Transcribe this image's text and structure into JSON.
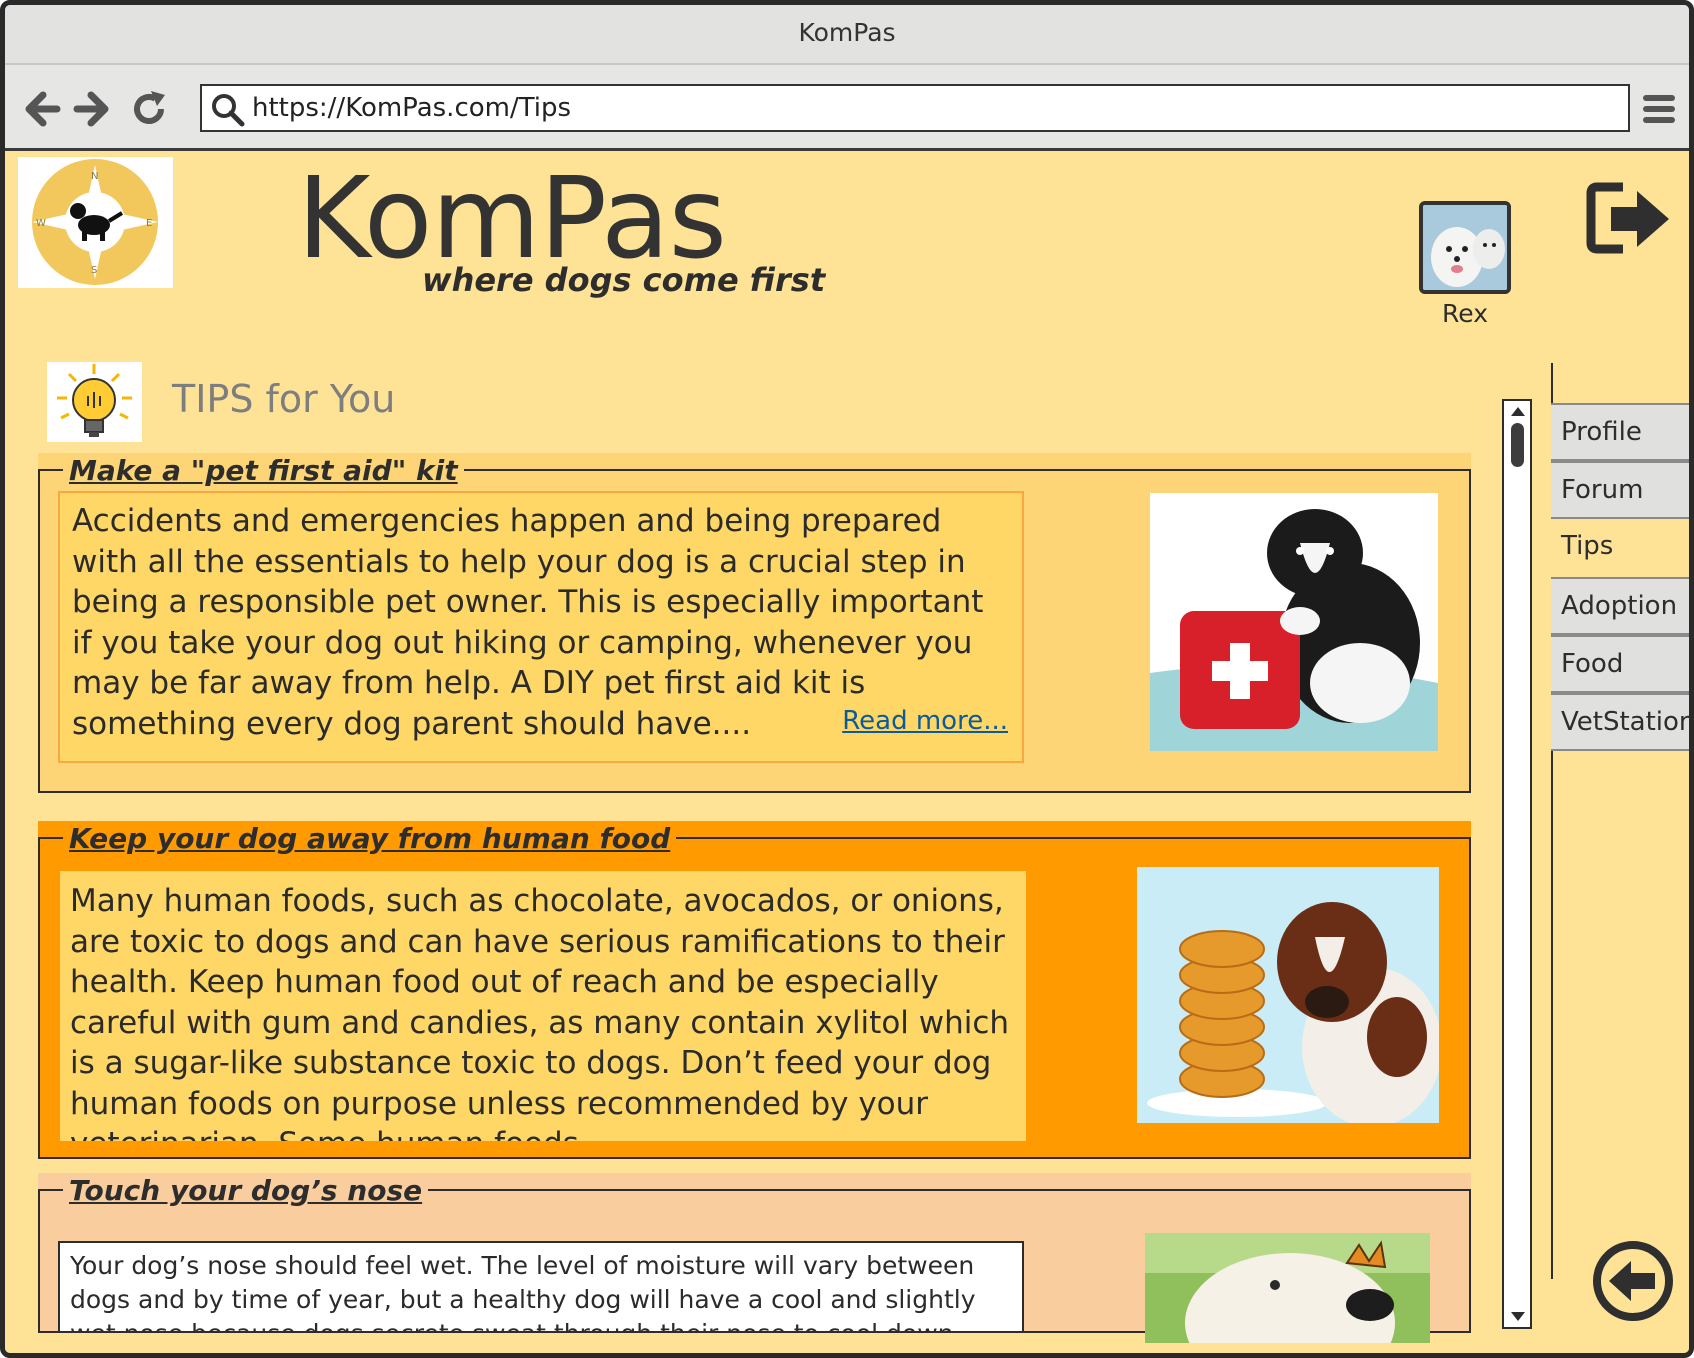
{
  "window": {
    "title": "KomPas"
  },
  "browser": {
    "url": "https://KomPas.com/Tips",
    "back_icon": "arrow-left-icon",
    "forward_icon": "arrow-right-icon",
    "reload_icon": "reload-icon",
    "menu_icon": "hamburger-menu-icon"
  },
  "header": {
    "brand": "KomPas",
    "tagline": "where dogs come first",
    "user": {
      "name": "Rex"
    }
  },
  "section": {
    "heading": "TIPS for You"
  },
  "tips": [
    {
      "title": "Make a \"pet first aid\" kit",
      "text": "Accidents and emergencies happen and being prepared with all the essentials to help your dog is a crucial step in being a responsible pet owner. This is especially important if you take your dog out hiking or camping, whenever you may be far away from help. A DIY pet first aid kit is something every dog parent should have....",
      "read_more": "Read more..."
    },
    {
      "title": "Keep your dog away from human food",
      "text": "Many human foods, such as chocolate, avocados, or onions, are toxic to dogs and can have serious ramifications to their health. Keep human food out of reach and be especially careful with gum and candies, as many contain xylitol which is a sugar-like substance toxic to dogs. Don’t feed your dog human foods on purpose unless recommended by your veterinarian. Some human foods..."
    },
    {
      "title": "Touch your dog’s nose",
      "text": "Your dog’s nose should feel wet. The level of moisture will vary between dogs and by time of year, but a healthy dog will have a cool and slightly wet nose because dogs secrete sweat through their nose to cool down."
    }
  ],
  "nav": {
    "tabs": [
      "Profile",
      "Forum",
      "Tips",
      "Adoption",
      "Food",
      "VetStation"
    ],
    "active": "Tips"
  },
  "colors": {
    "page_bg": "#fee397",
    "card1_bg": "#fed576",
    "card2_bg": "#ff9a00",
    "card3_bg": "#f9cd9e",
    "link": "#0b5a9a"
  }
}
